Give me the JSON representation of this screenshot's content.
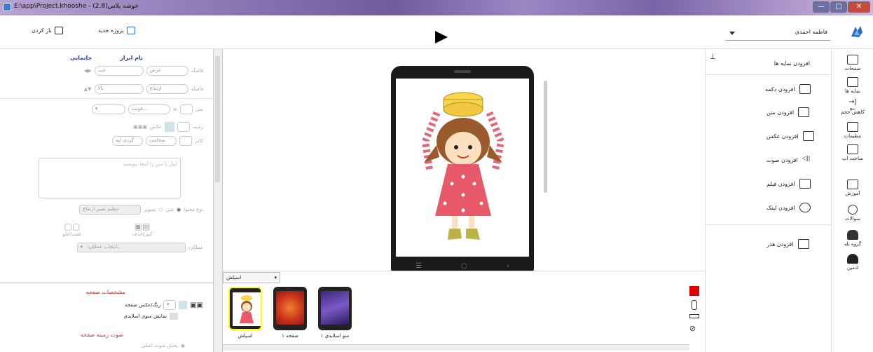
{
  "window": {
    "title": "E:\\app\\Project.khooshe - خوشه پلاس(2.8)",
    "buttons": [
      "—",
      "□",
      "✕"
    ]
  },
  "toolbar": {
    "open_label": "باز کردن",
    "new_project_label": "پروژه جدید",
    "user_name": "فاطمه احمدی"
  },
  "left_panel": {
    "tabs": [
      "جانمایی",
      "نام ابزار"
    ],
    "row1": {
      "label": "فاصله",
      "a": "عرض",
      "b": "چپ"
    },
    "row2": {
      "label": "فاصله",
      "a": "ارتفاع",
      "b": "بالا"
    },
    "text_label": "متن",
    "font_label": "فونت...",
    "background_label": "زمینه",
    "image_label": "عکس",
    "frame_label": "کادر",
    "thickness_label": "ضخامت",
    "rounded_label": "گردی لبه",
    "textarea_placeholder": "لیبل یا متن را اینجا بنویسید",
    "content_type_label": "نوع محتوا",
    "opt_text": "متن",
    "opt_image": "تصویر",
    "adjust_height_label": "تنظیم تغییر ارتفاع",
    "copy_delete_label": "کپی/حذف",
    "back_front_label": "عقب/جلو",
    "action_label": "عملکرد",
    "action_select": "انتخاب عملکرد...",
    "page_props_title": "مشخصات صفحه",
    "page_color_label": "رنگ/عکس صفحه",
    "slide_menu_label": "نمایش منوی اسلایدی",
    "page_sound_title": "صوت زمینه صفحه",
    "play_sound_label": "پخش صوت اصلی"
  },
  "right_panel": {
    "header": "افزودن نمایه ها",
    "items": [
      "افزودن دکمه",
      "افزودن متن",
      "افزودن عکس",
      "افزودن صوت",
      "افزودن فیلم",
      "افزودن لینک",
      "افزودن هدر"
    ]
  },
  "nav": {
    "items": [
      {
        "label": "صفحات"
      },
      {
        "label": "نمایه ها"
      },
      {
        "label": "کاهش حجم"
      },
      {
        "label": "تنظیمات"
      },
      {
        "label": "ساخت اپ"
      },
      {
        "label": "آموزش"
      },
      {
        "label": "سوالات"
      },
      {
        "label": "گروه بله"
      },
      {
        "label": "ادمین"
      }
    ]
  },
  "pages": {
    "dropdown": "اسپلش",
    "thumbs": [
      {
        "label": "اسپلش"
      },
      {
        "label": "صفحه ۱"
      },
      {
        "label": "منو اسلایدی ۱"
      }
    ]
  },
  "phone_nav": [
    "☰",
    "○",
    "‹"
  ],
  "colors": {
    "accent": "#2a6cc9",
    "section_title": "#cc3333",
    "tab_text": "#2a3cad",
    "record_button": "#dd0000"
  }
}
